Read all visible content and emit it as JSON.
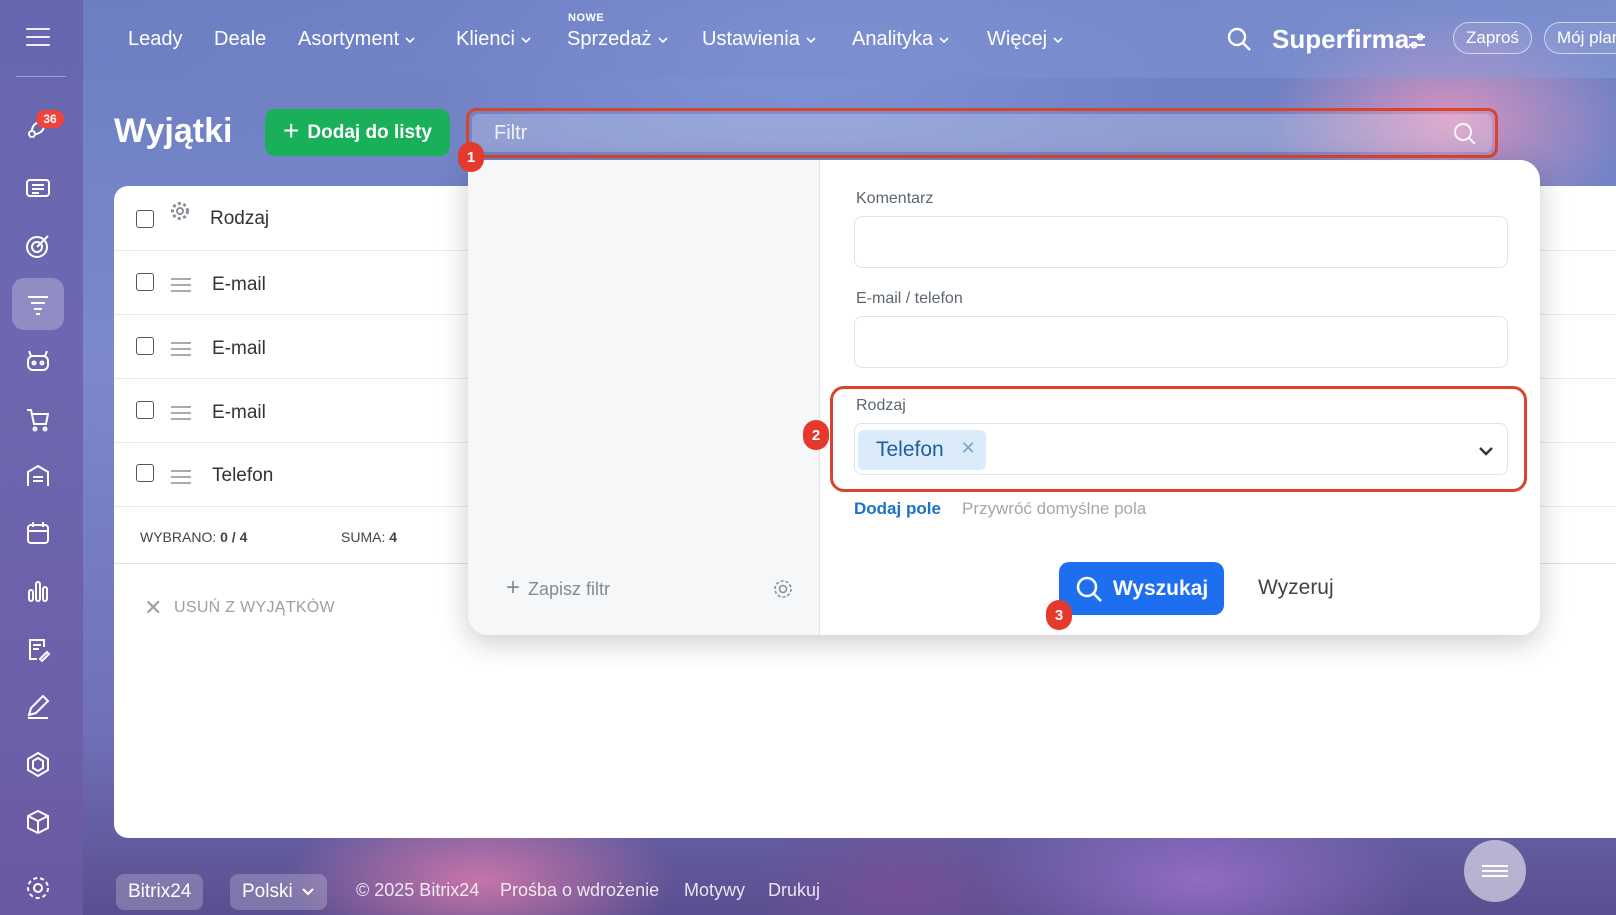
{
  "sidebar": {
    "badge_count": "36",
    "icons": [
      "menu-icon",
      "activity-icon",
      "contact-card-icon",
      "target-icon",
      "funnel-icon",
      "robot-icon",
      "cart-icon",
      "warehouse-icon",
      "calendar-icon",
      "bar-chart-icon",
      "document-edit-icon",
      "pen-icon",
      "hexagon-icon",
      "cube-icon",
      "settings-icon"
    ]
  },
  "topnav": {
    "items": [
      "Leady",
      "Deale",
      "Asortyment",
      "Klienci",
      "Sprzedaż",
      "Ustawienia",
      "Analityka",
      "Więcej"
    ],
    "new_label": "NOWE",
    "brand": "Superfirma",
    "invite_label": "Zaproś",
    "plan_label": "Mój plan"
  },
  "page": {
    "title": "Wyjątki",
    "add_button": "Dodaj do listy"
  },
  "filter": {
    "placeholder": "Filtr",
    "save_filter": "Zapisz filtr",
    "fields": {
      "comment_label": "Komentarz",
      "email_phone_label": "E-mail / telefon",
      "type_label": "Rodzaj",
      "type_value": "Telefon"
    },
    "add_field": "Dodaj pole",
    "restore_defaults": "Przywróć domyślne pola",
    "search_button": "Wyszukaj",
    "reset_button": "Wyzeruj"
  },
  "markers": [
    "1",
    "2",
    "3"
  ],
  "list": {
    "header": "Rodzaj",
    "rows": [
      "E-mail",
      "E-mail",
      "E-mail",
      "Telefon"
    ],
    "selected_label": "WYBRANO:",
    "selected_value": "0 / 4",
    "sum_label": "SUMA:",
    "sum_value": "4",
    "remove_action": "USUŃ Z WYJĄTKÓW"
  },
  "footer": {
    "brand": "Bitrix24",
    "language": "Polski",
    "copyright": "© 2025 Bitrix24",
    "links": [
      "Prośba o wdrożenie",
      "Motywy",
      "Drukuj"
    ]
  }
}
